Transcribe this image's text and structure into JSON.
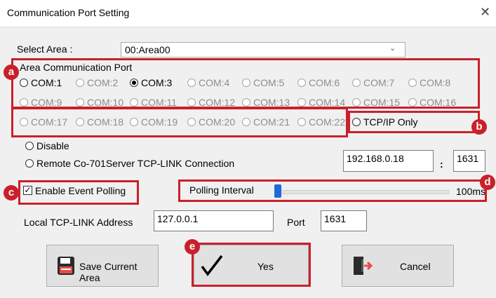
{
  "window": {
    "title": "Communication Port Setting",
    "close_glyph": "✕"
  },
  "select_area": {
    "label": "Select Area :",
    "value": "00:Area00"
  },
  "area_port": {
    "group_label": "Area Communication Port",
    "selected": "COM:3",
    "enabled": [
      "COM:1",
      "COM:3"
    ],
    "ports": [
      "COM:1",
      "COM:2",
      "COM:3",
      "COM:4",
      "COM:5",
      "COM:6",
      "COM:7",
      "COM:8",
      "COM:9",
      "COM:10",
      "COM:11",
      "COM:12",
      "COM:13",
      "COM:14",
      "COM:15",
      "COM:16",
      "COM:17",
      "COM:18",
      "COM:19",
      "COM:20",
      "COM:21",
      "COM:22"
    ],
    "tcp_only_label": "TCP/IP Only"
  },
  "disable_label": "Disable",
  "remote": {
    "label": "Remote Co-701Server TCP-LINK Connection",
    "ip": "192.168.0.18",
    "separator": ":",
    "port": "1631"
  },
  "event_polling": {
    "label": "Enable Event Polling",
    "checked": true
  },
  "polling_interval": {
    "label": "Polling Interval",
    "value_text": "100ms",
    "slider_fraction": 0.0
  },
  "local": {
    "label": "Local TCP-LINK Address",
    "address": "127.0.0.1",
    "port_label": "Port",
    "port": "1631"
  },
  "buttons": {
    "save": "Save Current Area",
    "yes": "Yes",
    "cancel": "Cancel"
  },
  "badges": {
    "a": "a",
    "b": "b",
    "c": "c",
    "d": "d",
    "e": "e"
  },
  "icons": {
    "save": "floppy-disk-icon",
    "yes": "checkmark-icon",
    "cancel": "exit-door-icon"
  },
  "colors": {
    "annotation_red": "#c9202b",
    "slider_blue": "#1e6ad8"
  }
}
